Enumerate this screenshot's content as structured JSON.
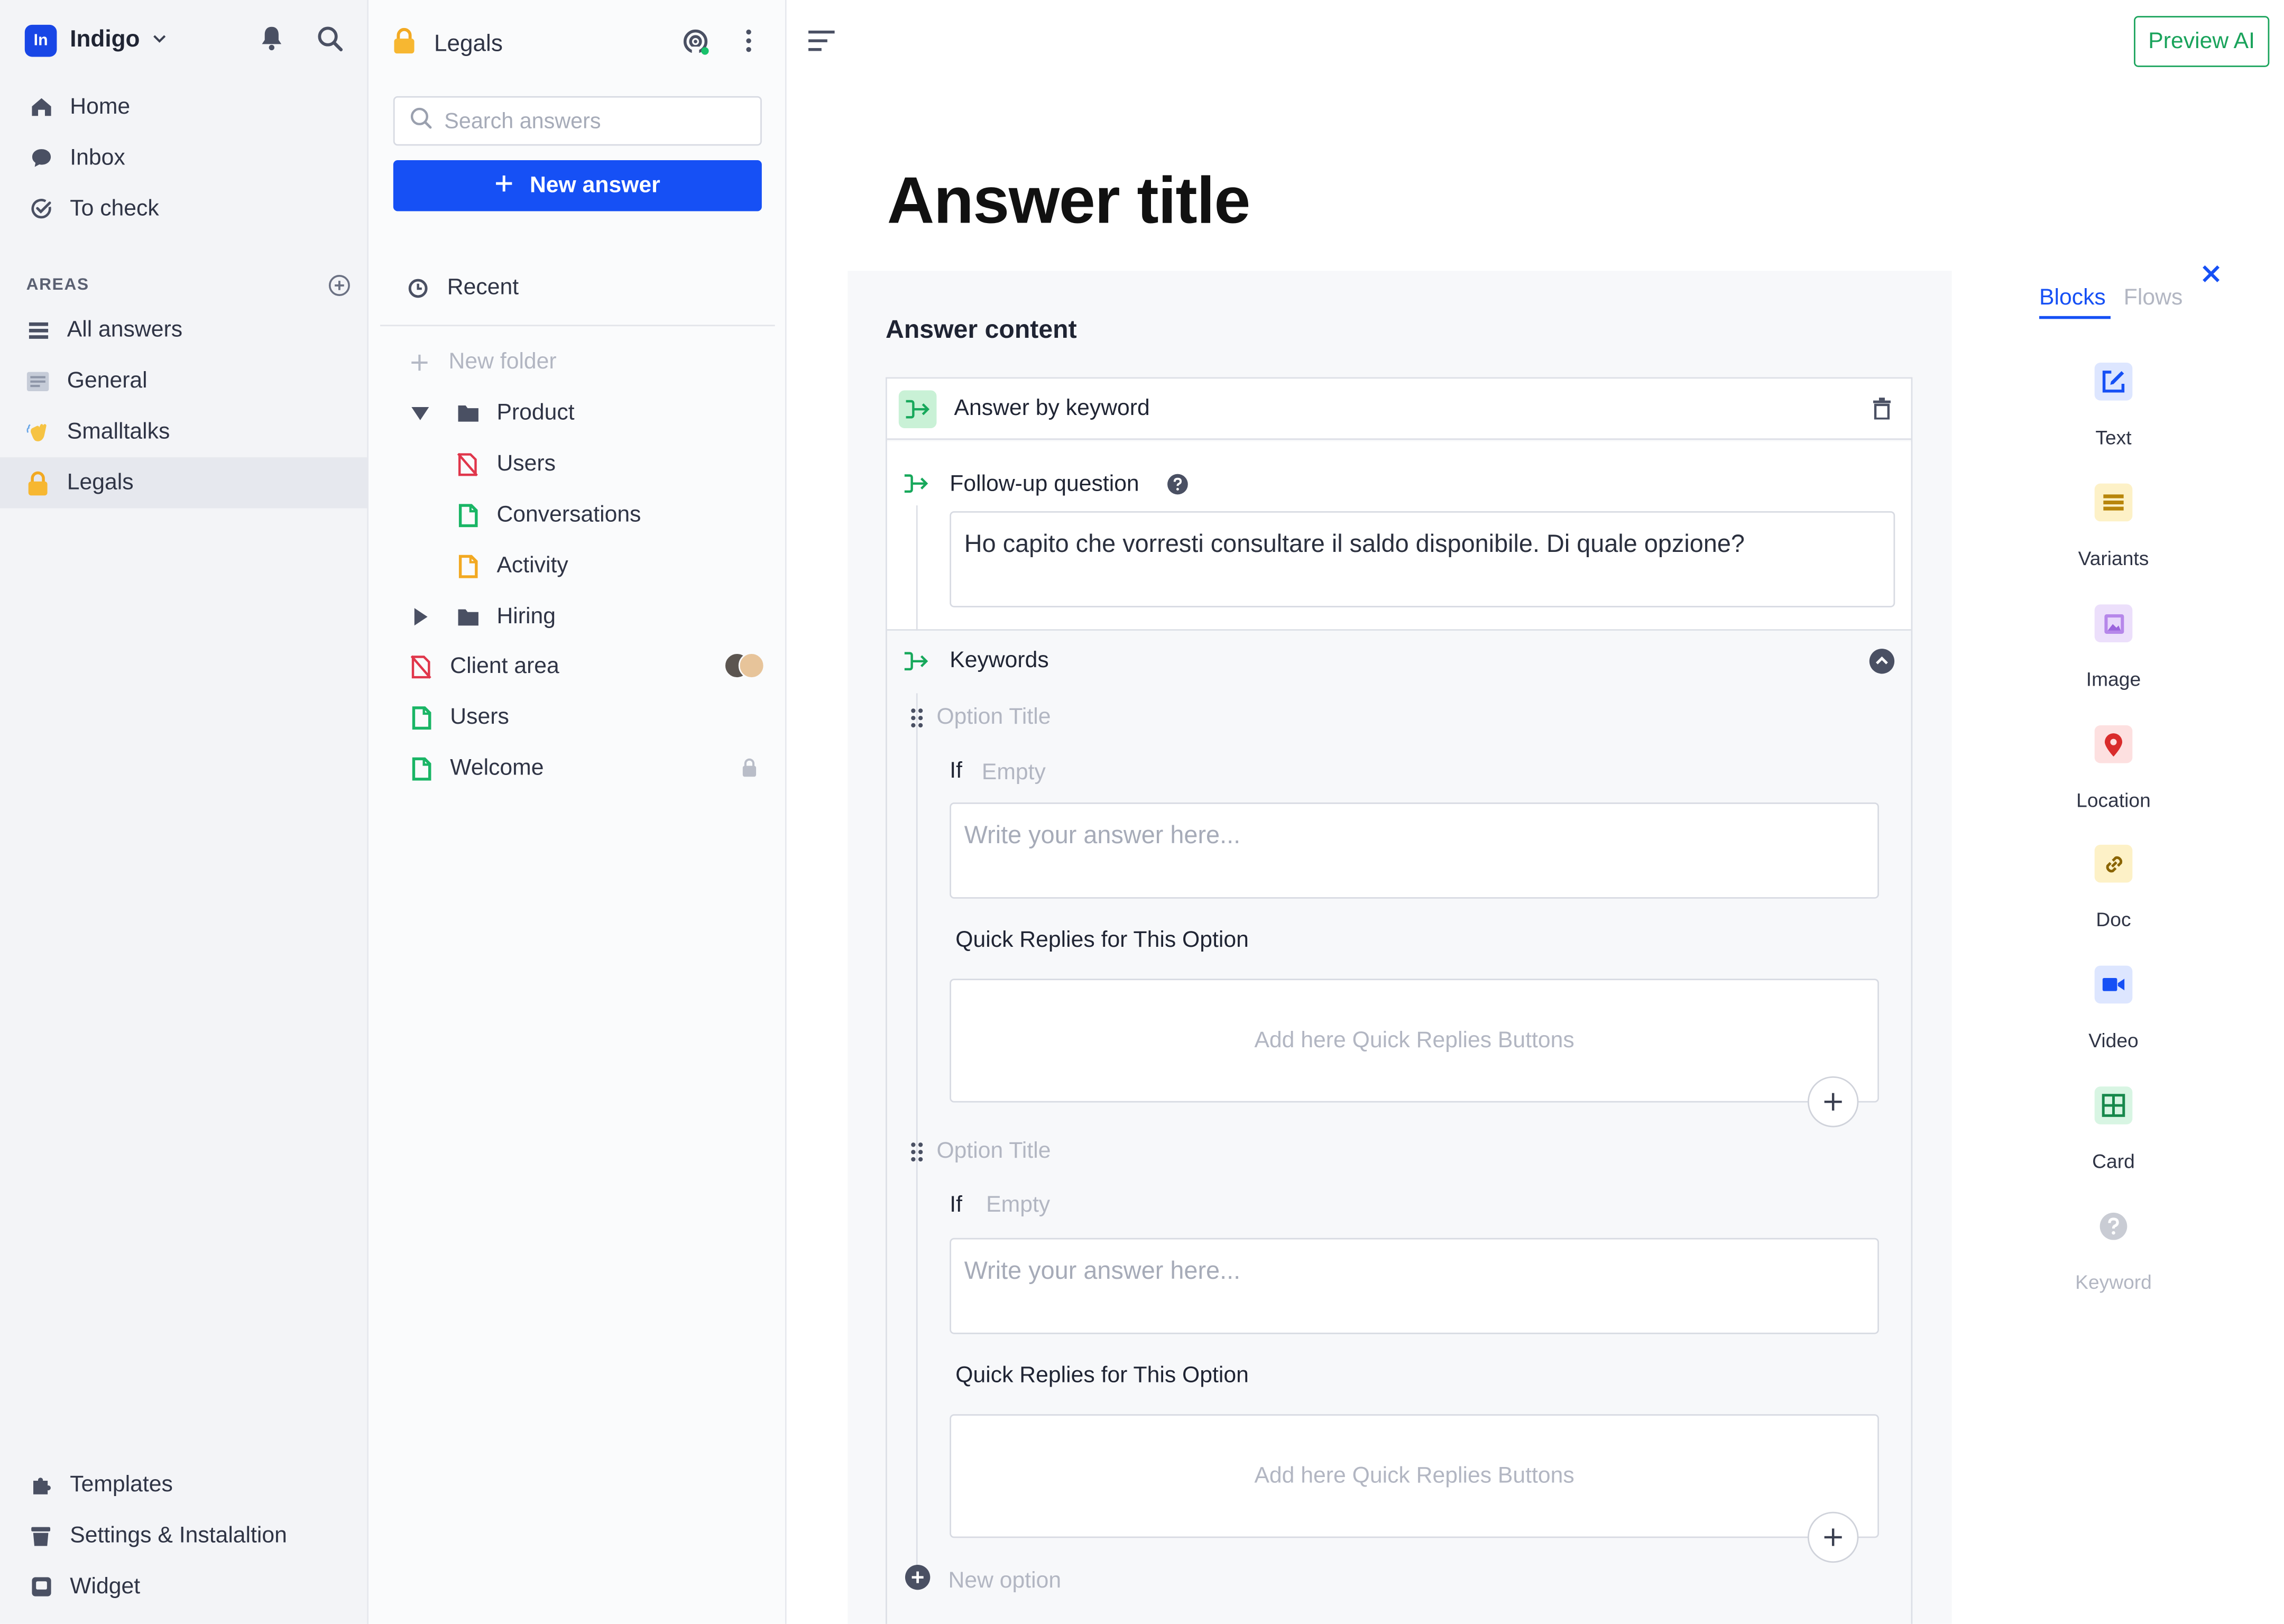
{
  "workspace": {
    "logo_text": "In",
    "name": "Indigo"
  },
  "nav": {
    "home": "Home",
    "inbox": "Inbox",
    "to_check": "To check"
  },
  "areas": {
    "label": "AREAS",
    "items": [
      {
        "label": "All answers"
      },
      {
        "label": "General"
      },
      {
        "label": "Smalltalks"
      },
      {
        "label": "Legals"
      }
    ]
  },
  "footer_nav": {
    "templates": "Templates",
    "settings": "Settings & Instalaltion",
    "widget": "Widget"
  },
  "folder_panel": {
    "title": "Legals",
    "search_placeholder": "Search answers",
    "new_answer": "New answer",
    "recent": "Recent",
    "new_folder": "New folder",
    "tree": {
      "product": "Product",
      "users": "Users",
      "conversations": "Conversations",
      "activity": "Activity",
      "hiring": "Hiring",
      "client_area": "Client area",
      "users_root": "Users",
      "welcome": "Welcome"
    }
  },
  "main": {
    "preview_button": "Preview AI",
    "answer_title": "Answer title",
    "answer_content_label": "Answer content",
    "block": {
      "title": "Answer by keyword",
      "followup_label": "Follow-up question",
      "followup_text": "Ho capito che vorresti consultare il saldo disponibile. Di quale opzione?",
      "keywords_label": "Keywords",
      "options": [
        {
          "title_placeholder": "Option Title",
          "if_label": "If",
          "if_value": "Empty",
          "answer_placeholder": "Write your answer here...",
          "quick_replies_label": "Quick Replies for This Option",
          "quick_replies_placeholder": "Add here Quick Replies Buttons"
        },
        {
          "title_placeholder": "Option Title",
          "if_label": "If",
          "if_value": "Empty",
          "answer_placeholder": "Write your answer here...",
          "quick_replies_label": "Quick Replies for This Option",
          "quick_replies_placeholder": "Add here Quick Replies Buttons"
        }
      ],
      "new_option": "New option"
    }
  },
  "palette": {
    "tabs": {
      "blocks": "Blocks",
      "flows": "Flows"
    },
    "items": [
      {
        "label": "Text",
        "icon": "edit-icon",
        "color": "#1650f5",
        "bg": "#dde6ff"
      },
      {
        "label": "Variants",
        "icon": "list-icon",
        "color": "#c28a00",
        "bg": "#fdf1c7"
      },
      {
        "label": "Image",
        "icon": "image-icon",
        "color": "#a36be0",
        "bg": "#ecdffb"
      },
      {
        "label": "Location",
        "icon": "pin-icon",
        "color": "#d92c2c",
        "bg": "#fde0e0"
      },
      {
        "label": "Doc",
        "icon": "link-icon",
        "color": "#a67a00",
        "bg": "#fdf1c7"
      },
      {
        "label": "Video",
        "icon": "video-icon",
        "color": "#1650f5",
        "bg": "#dde6ff"
      },
      {
        "label": "Card",
        "icon": "grid-icon",
        "color": "#16884b",
        "bg": "#d8f5e3"
      },
      {
        "label": "Keyword",
        "icon": "help-icon",
        "color": "#c4c7d0",
        "bg": "transparent"
      }
    ]
  },
  "colors": {
    "primary": "#1650f5",
    "success": "#19a35b",
    "sidebar_bg": "#f3f4f7"
  }
}
